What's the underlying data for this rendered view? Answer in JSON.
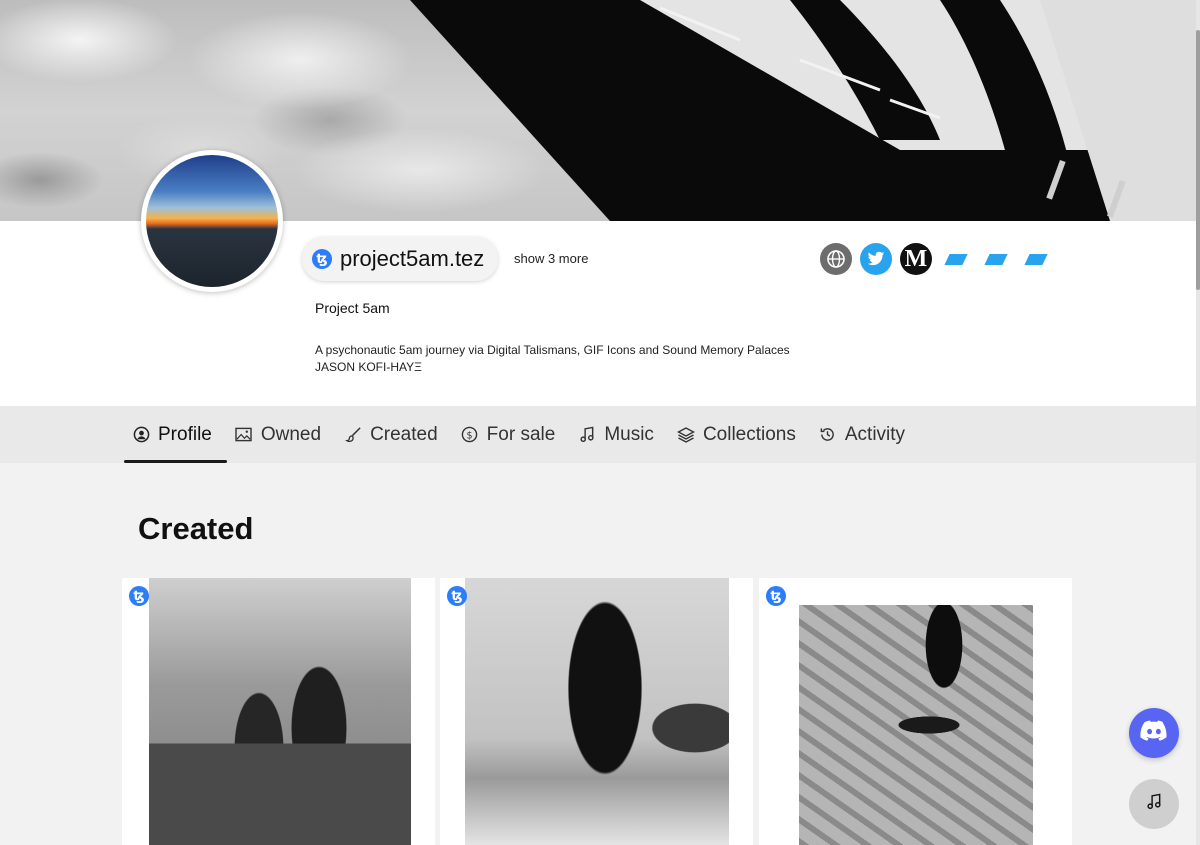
{
  "profile": {
    "tezos_symbol": "ꜩ",
    "domain_name": "project5am.tez",
    "show_more": "show 3 more",
    "display_name": "Project 5am",
    "bio_line1": "A psychonautic 5am journey via Digital Talismans, GIF Icons and Sound Memory Palaces",
    "bio_line2": "JASON KOFI-HAYΞ"
  },
  "socials": [
    {
      "name": "website",
      "icon": "globe-icon"
    },
    {
      "name": "twitter",
      "icon": "twitter-icon"
    },
    {
      "name": "medium",
      "icon": "medium-icon",
      "glyph": "M"
    },
    {
      "name": "link-1",
      "icon": "parallelogram-icon"
    },
    {
      "name": "link-2",
      "icon": "parallelogram-icon"
    },
    {
      "name": "link-3",
      "icon": "parallelogram-icon"
    }
  ],
  "tabs": [
    {
      "label": "Profile",
      "icon": "user-circle-icon",
      "active": true
    },
    {
      "label": "Owned",
      "icon": "image-icon"
    },
    {
      "label": "Created",
      "icon": "brush-icon"
    },
    {
      "label": "For sale",
      "icon": "coin-icon"
    },
    {
      "label": "Music",
      "icon": "music-note-icon"
    },
    {
      "label": "Collections",
      "icon": "layers-icon"
    },
    {
      "label": "Activity",
      "icon": "history-icon"
    }
  ],
  "section": {
    "title": "Created"
  },
  "cards": [
    {
      "badge": "ꜩ"
    },
    {
      "badge": "ꜩ"
    },
    {
      "badge": "ꜩ"
    }
  ],
  "colors": {
    "tezos_blue": "#2c7df7",
    "twitter_blue": "#2aa3ef",
    "discord": "#5865f2"
  }
}
